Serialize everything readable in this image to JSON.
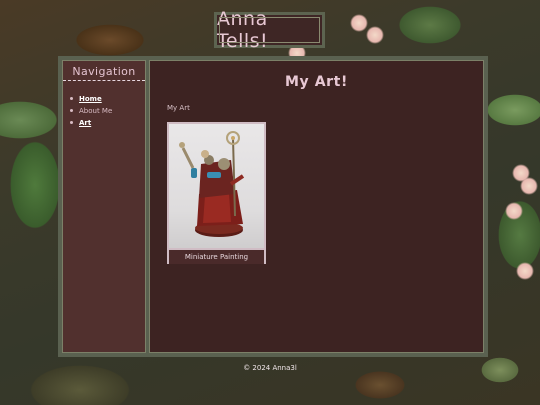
{
  "header": {
    "title": "Anna Tells!"
  },
  "sidebar": {
    "heading": "Navigation",
    "items": [
      {
        "label": "Home",
        "is_link": true
      },
      {
        "label": "About Me",
        "is_link": false
      },
      {
        "label": "Art",
        "is_link": true
      }
    ]
  },
  "main": {
    "title": "My Art!",
    "subtitle": "My Art",
    "gallery": [
      {
        "caption": "Miniature Painting"
      }
    ]
  },
  "footer": {
    "text": "© 2024 Anna3l"
  },
  "colors": {
    "panel_dark": "#3d2322",
    "sidebar": "#51302e",
    "border": "#5a6150",
    "heading_pink": "#e8c8d4"
  }
}
